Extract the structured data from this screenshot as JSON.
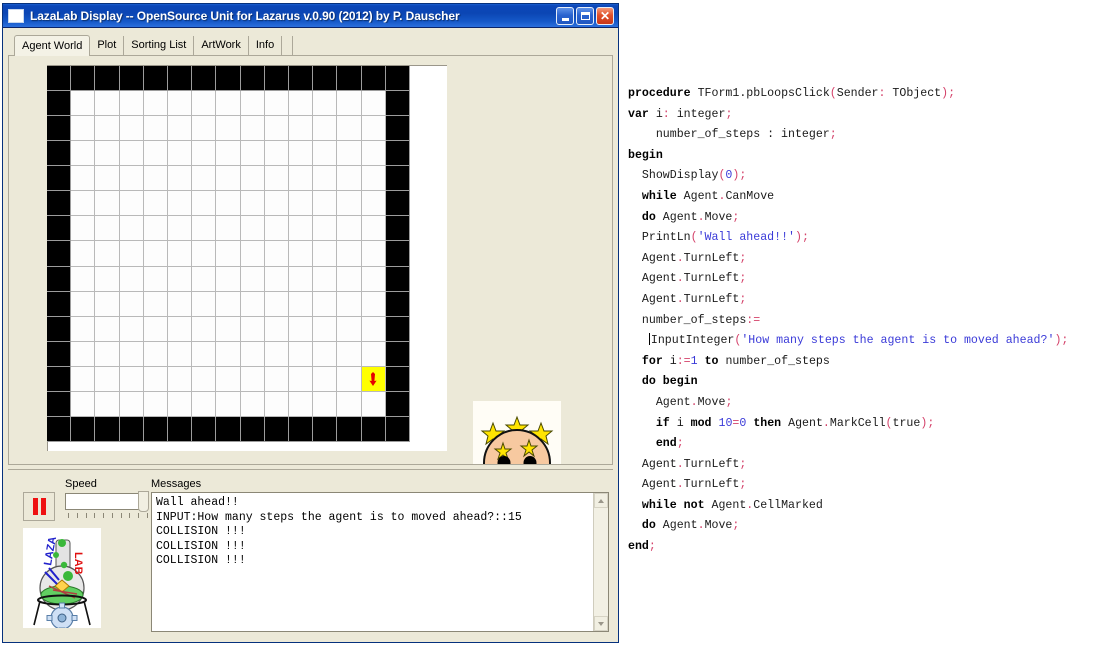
{
  "window": {
    "title": "LazaLab Display -- OpenSource Unit for Lazarus  v.0.90 (2012) by P. Dauscher",
    "icon": "window-icon",
    "buttons": {
      "minimize": "_",
      "maximize": "□",
      "close": "✕"
    }
  },
  "tabs": [
    {
      "label": "Agent World",
      "active": true
    },
    {
      "label": "Plot",
      "active": false
    },
    {
      "label": "Sorting List",
      "active": false
    },
    {
      "label": "ArtWork",
      "active": false
    },
    {
      "label": "Info",
      "active": false
    }
  ],
  "agent_world": {
    "columns": 15,
    "rows": 15,
    "agent": {
      "col": 13,
      "row": 12,
      "direction": "down",
      "cell_marked": true
    },
    "marked_cell_color": "#ffff00",
    "wall_color": "#000000",
    "floor_color": "#fdfdfd"
  },
  "artwork": {
    "name": "sad-dizzy-face",
    "face_color": "#f7c9a0",
    "star_color": "#ffe400",
    "stars": 5
  },
  "controls": {
    "speed_label": "Speed",
    "pause_button": "pause-button",
    "slider_value": 100,
    "slider_ticks": 10,
    "logo": {
      "text_left": "LAZA",
      "text_right": "LAB"
    }
  },
  "messages": {
    "label": "Messages",
    "lines": [
      "Wall ahead!!",
      "INPUT:How many steps the agent is to moved ahead?::15",
      "COLLISION !!!",
      "COLLISION !!!",
      "COLLISION !!!"
    ]
  },
  "code": {
    "lines": [
      [
        {
          "t": "procedure",
          "c": "kw"
        },
        {
          "t": " TForm1.pbLoopsClick",
          "c": ""
        },
        {
          "t": "(",
          "c": "pn"
        },
        {
          "t": "Sender",
          "c": ""
        },
        {
          "t": ":",
          "c": "pn"
        },
        {
          "t": " TObject",
          "c": ""
        },
        {
          "t": ");",
          "c": "pn"
        }
      ],
      [
        {
          "t": "var",
          "c": "kw"
        },
        {
          "t": " i",
          "c": ""
        },
        {
          "t": ":",
          "c": "pn"
        },
        {
          "t": " integer",
          "c": ""
        },
        {
          "t": ";",
          "c": "pn"
        }
      ],
      [
        {
          "t": "    number_of_steps : integer",
          "c": ""
        },
        {
          "t": ";",
          "c": "pn"
        }
      ],
      [
        {
          "t": "begin",
          "c": "kw"
        }
      ],
      [
        {
          "t": "  ShowDisplay",
          "c": ""
        },
        {
          "t": "(",
          "c": "pn"
        },
        {
          "t": "0",
          "c": "nm"
        },
        {
          "t": ");",
          "c": "pn"
        }
      ],
      [
        {
          "t": "  ",
          "c": ""
        },
        {
          "t": "while",
          "c": "kw"
        },
        {
          "t": " Agent",
          "c": ""
        },
        {
          "t": ".",
          "c": "pn"
        },
        {
          "t": "CanMove",
          "c": ""
        }
      ],
      [
        {
          "t": "  ",
          "c": ""
        },
        {
          "t": "do",
          "c": "kw"
        },
        {
          "t": " Agent",
          "c": ""
        },
        {
          "t": ".",
          "c": "pn"
        },
        {
          "t": "Move",
          "c": ""
        },
        {
          "t": ";",
          "c": "pn"
        }
      ],
      [
        {
          "t": "  PrintLn",
          "c": ""
        },
        {
          "t": "(",
          "c": "pn"
        },
        {
          "t": "'Wall ahead!!'",
          "c": "st"
        },
        {
          "t": ");",
          "c": "pn"
        }
      ],
      [
        {
          "t": "  Agent",
          "c": ""
        },
        {
          "t": ".",
          "c": "pn"
        },
        {
          "t": "TurnLeft",
          "c": ""
        },
        {
          "t": ";",
          "c": "pn"
        }
      ],
      [
        {
          "t": "  Agent",
          "c": ""
        },
        {
          "t": ".",
          "c": "pn"
        },
        {
          "t": "TurnLeft",
          "c": ""
        },
        {
          "t": ";",
          "c": "pn"
        }
      ],
      [
        {
          "t": "  Agent",
          "c": ""
        },
        {
          "t": ".",
          "c": "pn"
        },
        {
          "t": "TurnLeft",
          "c": ""
        },
        {
          "t": ";",
          "c": "pn"
        }
      ],
      [
        {
          "t": "  number_of_steps",
          "c": ""
        },
        {
          "t": ":=",
          "c": "pn"
        }
      ],
      [
        {
          "t": "   ",
          "c": ""
        },
        {
          "t": "|",
          "c": "cur"
        },
        {
          "t": "InputInteger",
          "c": ""
        },
        {
          "t": "(",
          "c": "pn"
        },
        {
          "t": "'How many steps the agent is to moved ahead?'",
          "c": "st"
        },
        {
          "t": ");",
          "c": "pn"
        }
      ],
      [
        {
          "t": "  ",
          "c": ""
        },
        {
          "t": "for",
          "c": "kw"
        },
        {
          "t": " i",
          "c": ""
        },
        {
          "t": ":=",
          "c": "pn"
        },
        {
          "t": "1",
          "c": "nm"
        },
        {
          "t": " ",
          "c": ""
        },
        {
          "t": "to",
          "c": "kw"
        },
        {
          "t": " number_of_steps",
          "c": ""
        }
      ],
      [
        {
          "t": "  ",
          "c": ""
        },
        {
          "t": "do begin",
          "c": "kw"
        }
      ],
      [
        {
          "t": "    Agent",
          "c": ""
        },
        {
          "t": ".",
          "c": "pn"
        },
        {
          "t": "Move",
          "c": ""
        },
        {
          "t": ";",
          "c": "pn"
        }
      ],
      [
        {
          "t": "    ",
          "c": ""
        },
        {
          "t": "if",
          "c": "kw"
        },
        {
          "t": " i ",
          "c": ""
        },
        {
          "t": "mod",
          "c": "kw"
        },
        {
          "t": " ",
          "c": ""
        },
        {
          "t": "10",
          "c": "nm"
        },
        {
          "t": "=",
          "c": "pn"
        },
        {
          "t": "0",
          "c": "nm"
        },
        {
          "t": " ",
          "c": ""
        },
        {
          "t": "then",
          "c": "kw"
        },
        {
          "t": " Agent",
          "c": ""
        },
        {
          "t": ".",
          "c": "pn"
        },
        {
          "t": "MarkCell",
          "c": ""
        },
        {
          "t": "(",
          "c": "pn"
        },
        {
          "t": "true",
          "c": ""
        },
        {
          "t": ");",
          "c": "pn"
        }
      ],
      [
        {
          "t": "    ",
          "c": ""
        },
        {
          "t": "end",
          "c": "kw"
        },
        {
          "t": ";",
          "c": "pn"
        }
      ],
      [
        {
          "t": "  Agent",
          "c": ""
        },
        {
          "t": ".",
          "c": "pn"
        },
        {
          "t": "TurnLeft",
          "c": ""
        },
        {
          "t": ";",
          "c": "pn"
        }
      ],
      [
        {
          "t": "  Agent",
          "c": ""
        },
        {
          "t": ".",
          "c": "pn"
        },
        {
          "t": "TurnLeft",
          "c": ""
        },
        {
          "t": ";",
          "c": "pn"
        }
      ],
      [
        {
          "t": "  ",
          "c": ""
        },
        {
          "t": "while not",
          "c": "kw"
        },
        {
          "t": " Agent",
          "c": ""
        },
        {
          "t": ".",
          "c": "pn"
        },
        {
          "t": "CellMarked",
          "c": ""
        }
      ],
      [
        {
          "t": "  ",
          "c": ""
        },
        {
          "t": "do",
          "c": "kw"
        },
        {
          "t": " Agent",
          "c": ""
        },
        {
          "t": ".",
          "c": "pn"
        },
        {
          "t": "Move",
          "c": ""
        },
        {
          "t": ";",
          "c": "pn"
        }
      ],
      [
        {
          "t": "end",
          "c": "kw"
        },
        {
          "t": ";",
          "c": "pn"
        }
      ]
    ]
  }
}
